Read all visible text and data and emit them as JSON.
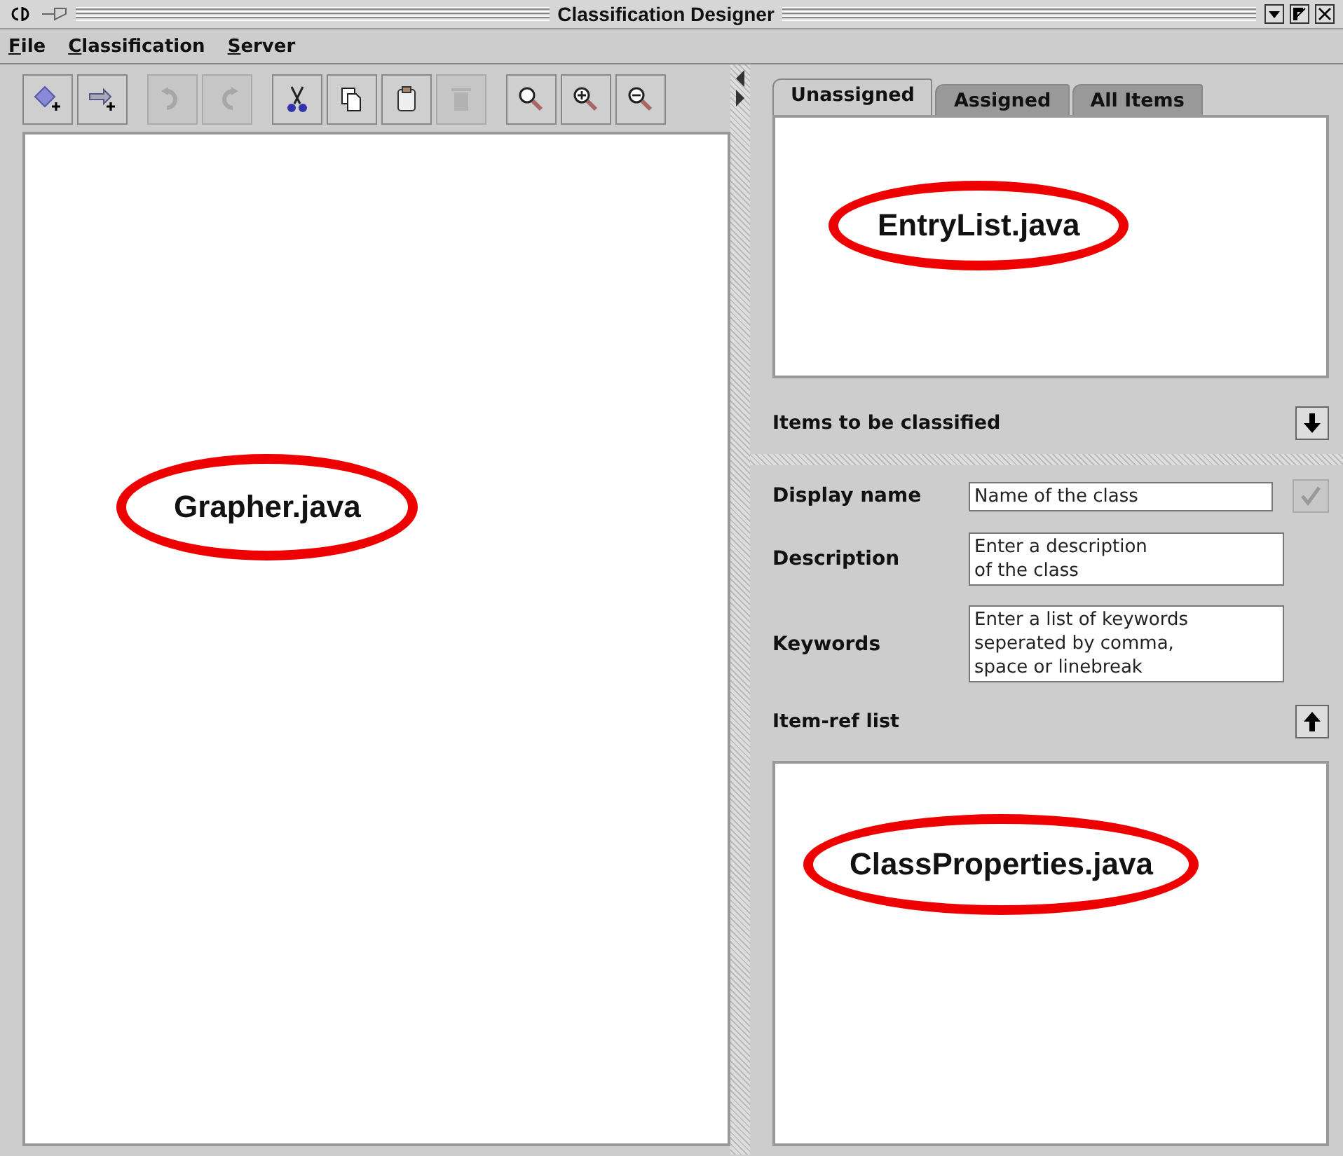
{
  "window": {
    "title": "Classification Designer"
  },
  "menu": [
    {
      "label": "File"
    },
    {
      "label": "Classification"
    },
    {
      "label": "Server"
    }
  ],
  "toolbar": {
    "groups": [
      [
        {
          "kind": "add-node",
          "disabled": false
        },
        {
          "kind": "add-edge",
          "disabled": false
        }
      ],
      [
        {
          "kind": "undo",
          "disabled": true
        },
        {
          "kind": "redo",
          "disabled": true
        }
      ],
      [
        {
          "kind": "cut",
          "disabled": false
        },
        {
          "kind": "copy",
          "disabled": false
        },
        {
          "kind": "paste",
          "disabled": false
        },
        {
          "kind": "delete",
          "disabled": true
        }
      ],
      [
        {
          "kind": "zoom",
          "disabled": false
        },
        {
          "kind": "zoom-in",
          "disabled": false
        },
        {
          "kind": "zoom-out",
          "disabled": false
        }
      ]
    ]
  },
  "canvas": {
    "annotation": "Grapher.java"
  },
  "tabs": [
    {
      "label": "Unassigned",
      "selected": true
    },
    {
      "label": "Assigned",
      "selected": false
    },
    {
      "label": "All Items",
      "selected": false
    }
  ],
  "items_list": {
    "annotation": "EntryList.java"
  },
  "items_header": {
    "label": "Items to be classified"
  },
  "form": {
    "fields": [
      {
        "label": "Display name",
        "value": "Name of the class",
        "kind": "line"
      },
      {
        "label": "Description",
        "value": "Enter a description\nof the class",
        "kind": "area"
      },
      {
        "label": "Keywords",
        "value": "Enter a list of keywords\nseperated by comma,\nspace or linebreak",
        "kind": "area"
      }
    ],
    "confirm": {
      "disabled": true
    }
  },
  "item_ref": {
    "label": "Item-ref list",
    "annotation": "ClassProperties.java"
  }
}
